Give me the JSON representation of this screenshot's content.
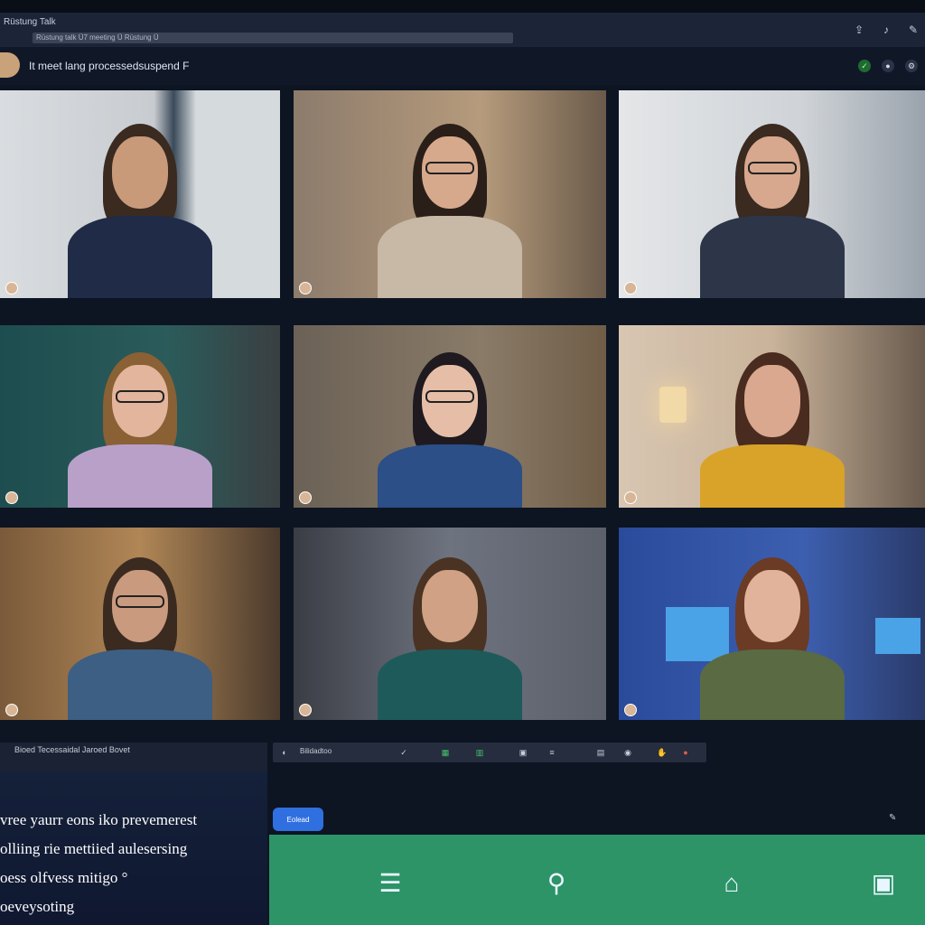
{
  "window": {
    "title": "Rüstung Talk",
    "url_text": "Rüstung talk Ü7 meeting Ü Rüstung Ü"
  },
  "meeting": {
    "title": "It meet lang processedsuspend F"
  },
  "top_icons": [
    "share-icon",
    "bell-icon",
    "pin-icon"
  ],
  "status_icons": [
    "shield-icon",
    "record-icon",
    "settings-icon"
  ],
  "participants": [
    {
      "name": "",
      "scene": "office-window",
      "skin": "#c89a7a",
      "hair": "#3a2a20",
      "shirt": "#1f2b47",
      "glasses": false
    },
    {
      "name": "",
      "scene": "bookshelf",
      "skin": "#d7a98c",
      "hair": "#2a1e18",
      "shirt": "#c7b9a6",
      "glasses": true
    },
    {
      "name": "",
      "scene": "studio",
      "skin": "#d7a88d",
      "hair": "#3a2a20",
      "shirt": "#2d3548",
      "glasses": true
    },
    {
      "name": "",
      "scene": "teal-wall",
      "skin": "#e2b59c",
      "hair": "#8a6035",
      "shirt": "#b9a0c9",
      "glasses": true
    },
    {
      "name": "",
      "scene": "warm-room",
      "skin": "#e6bea7",
      "hair": "#1e1a1f",
      "shirt": "#2b4f86",
      "glasses": true
    },
    {
      "name": "",
      "scene": "lamp-room",
      "skin": "#d9a88e",
      "hair": "#4a2b1f",
      "shirt": "#d8a328",
      "glasses": false
    },
    {
      "name": "",
      "scene": "library",
      "skin": "#c99a7e",
      "hair": "#3a2a20",
      "shirt": "#3d5f83",
      "glasses": true
    },
    {
      "name": "",
      "scene": "grey-wall",
      "skin": "#d0a184",
      "hair": "#4a3323",
      "shirt": "#1f5a5a",
      "glasses": false
    },
    {
      "name": "",
      "scene": "blue-office",
      "skin": "#e1b39a",
      "hair": "#6b3b25",
      "shirt": "#5a6a43",
      "glasses": false
    }
  ],
  "chat": {
    "header": "Bioed  Tecessaidal  Jaroed  Bovet",
    "lines": [
      "vree yaurr eons iko prevemerest",
      "olliing rie mettiied aulesersing",
      "oess olfvess mitigo °",
      "oeveysoting"
    ]
  },
  "toolbar": {
    "label": "Bilidadtoo",
    "icons": [
      "check-icon",
      "sheet-icon",
      "chart-icon",
      "camera-icon",
      "list-icon",
      "grid-icon",
      "mic-icon",
      "hand-icon"
    ]
  },
  "primary_button": "Eolead",
  "action_bar": {
    "actions": [
      "notes-icon",
      "search-icon",
      "tag-icon",
      "presentation-icon"
    ]
  },
  "colors": {
    "accent": "#2f6fe0",
    "action_bar": "#2c9467",
    "background": "#0d1422"
  }
}
